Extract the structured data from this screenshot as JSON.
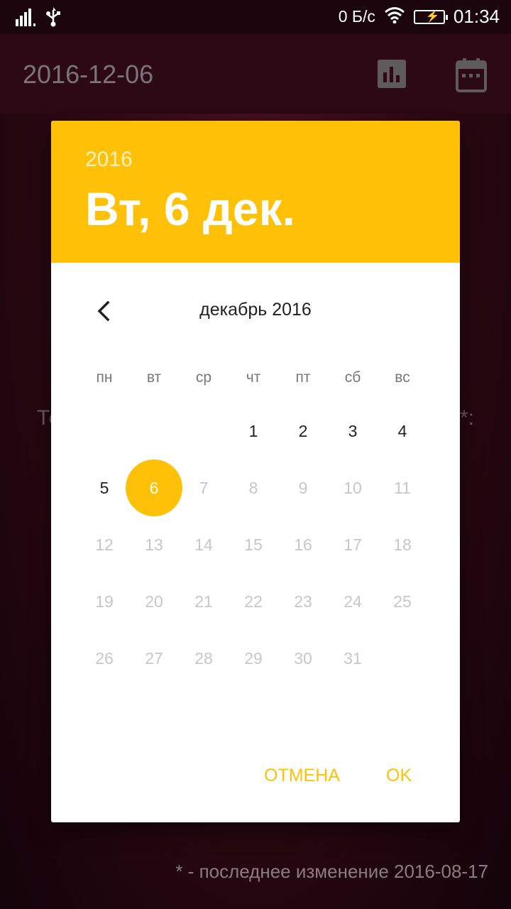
{
  "status_bar": {
    "data_rate": "0 Б/с",
    "time": "01:34",
    "icons": [
      "signal-icon",
      "usb-icon",
      "wifi-icon",
      "battery-charging-icon"
    ]
  },
  "app_bar": {
    "title": "2016-12-06",
    "icons": [
      "bar-chart-icon",
      "calendar-icon"
    ]
  },
  "background": {
    "label_left": "Те",
    "label_right": "*:",
    "footer": "* - последнее изменение 2016-08-17"
  },
  "dialog": {
    "header": {
      "year": "2016",
      "date": "Вт, 6 дек."
    },
    "month_title": "декабрь 2016",
    "weekdays": [
      "пн",
      "вт",
      "ср",
      "чт",
      "пт",
      "сб",
      "вс"
    ],
    "weeks": [
      [
        "",
        "",
        "",
        "1",
        "2",
        "3",
        "4"
      ],
      [
        "5",
        "6",
        "7",
        "8",
        "9",
        "10",
        "11"
      ],
      [
        "12",
        "13",
        "14",
        "15",
        "16",
        "17",
        "18"
      ],
      [
        "19",
        "20",
        "21",
        "22",
        "23",
        "24",
        "25"
      ],
      [
        "26",
        "27",
        "28",
        "29",
        "30",
        "31",
        ""
      ]
    ],
    "selected_day": "6",
    "cancel_label": "ОТМЕНА",
    "ok_label": "OK"
  },
  "colors": {
    "accent": "#ffc107",
    "dialog_bg": "#ffffff",
    "background": "#2a0812"
  }
}
